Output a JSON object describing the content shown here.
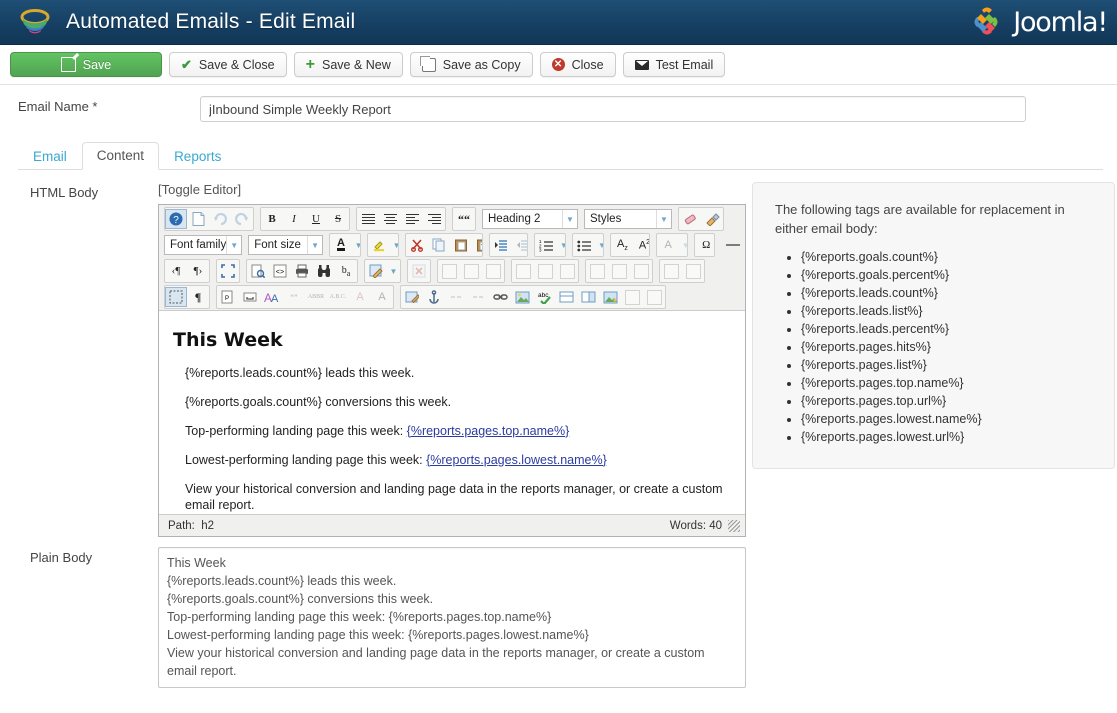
{
  "header": {
    "title": "Automated Emails - Edit Email",
    "brand_text": "Joomla!",
    "logo_icon": "joomla-swirl-icon",
    "brand_icon": "joomla-j-icon"
  },
  "toolbar": {
    "buttons": [
      {
        "label": "Save",
        "icon": "pencil-square-icon",
        "style": "primary"
      },
      {
        "label": "Save & Close",
        "icon": "check-icon",
        "style": "default"
      },
      {
        "label": "Save & New",
        "icon": "plus-icon",
        "style": "default"
      },
      {
        "label": "Save as Copy",
        "icon": "copy-icon",
        "style": "default"
      },
      {
        "label": "Close",
        "icon": "close-circle-icon",
        "style": "default"
      },
      {
        "label": "Test Email",
        "icon": "envelope-icon",
        "style": "default"
      }
    ]
  },
  "form": {
    "email_name_label": "Email Name *",
    "email_name_value": "jInbound Simple Weekly Report",
    "email_name_placeholder": ""
  },
  "tabs": [
    {
      "label": "Email",
      "active": false
    },
    {
      "label": "Content",
      "active": true
    },
    {
      "label": "Reports",
      "active": false
    }
  ],
  "html_body": {
    "label": "HTML Body",
    "toggle_editor": "[Toggle Editor]",
    "editor": {
      "heading_select": "Heading 2",
      "styles_select": "Styles",
      "fontfamily_select": "Font family",
      "fontsize_select": "Font size",
      "status_path_label": "Path:",
      "status_path_value": "h2",
      "status_words": "Words: 40"
    },
    "content": {
      "heading": "This Week",
      "line1": "{%reports.leads.count%} leads this week.",
      "line2": "{%reports.goals.count%} conversions this week.",
      "line3_prefix": "Top-performing landing page this week: ",
      "line3_link": "{%reports.pages.top.name%}",
      "line4_prefix": "Lowest-performing landing page this week: ",
      "line4_link": "{%reports.pages.lowest.name%}",
      "line5": "View your historical conversion and landing page data in the reports manager, or create a custom email report."
    }
  },
  "plain_body": {
    "label": "Plain Body",
    "value": "This Week\n{%reports.leads.count%} leads this week.\n{%reports.goals.count%} conversions this week.\nTop-performing landing page this week: {%reports.pages.top.name%}\nLowest-performing landing page this week: {%reports.pages.lowest.name%}\nView your historical conversion and landing page data in the reports manager, or create a custom email report."
  },
  "tags_panel": {
    "intro": "The following tags are available for replacement in either email body:",
    "tags": [
      "{%reports.goals.count%}",
      "{%reports.goals.percent%}",
      "{%reports.leads.count%}",
      "{%reports.leads.list%}",
      "{%reports.leads.percent%}",
      "{%reports.pages.hits%}",
      "{%reports.pages.list%}",
      "{%reports.pages.top.name%}",
      "{%reports.pages.top.url%}",
      "{%reports.pages.lowest.name%}",
      "{%reports.pages.lowest.url%}"
    ]
  },
  "colors": {
    "header_bg": "#16405f",
    "save_green": "#51a351",
    "tab_link": "#3aa8d0",
    "link_blue": "#2b3ba0"
  }
}
